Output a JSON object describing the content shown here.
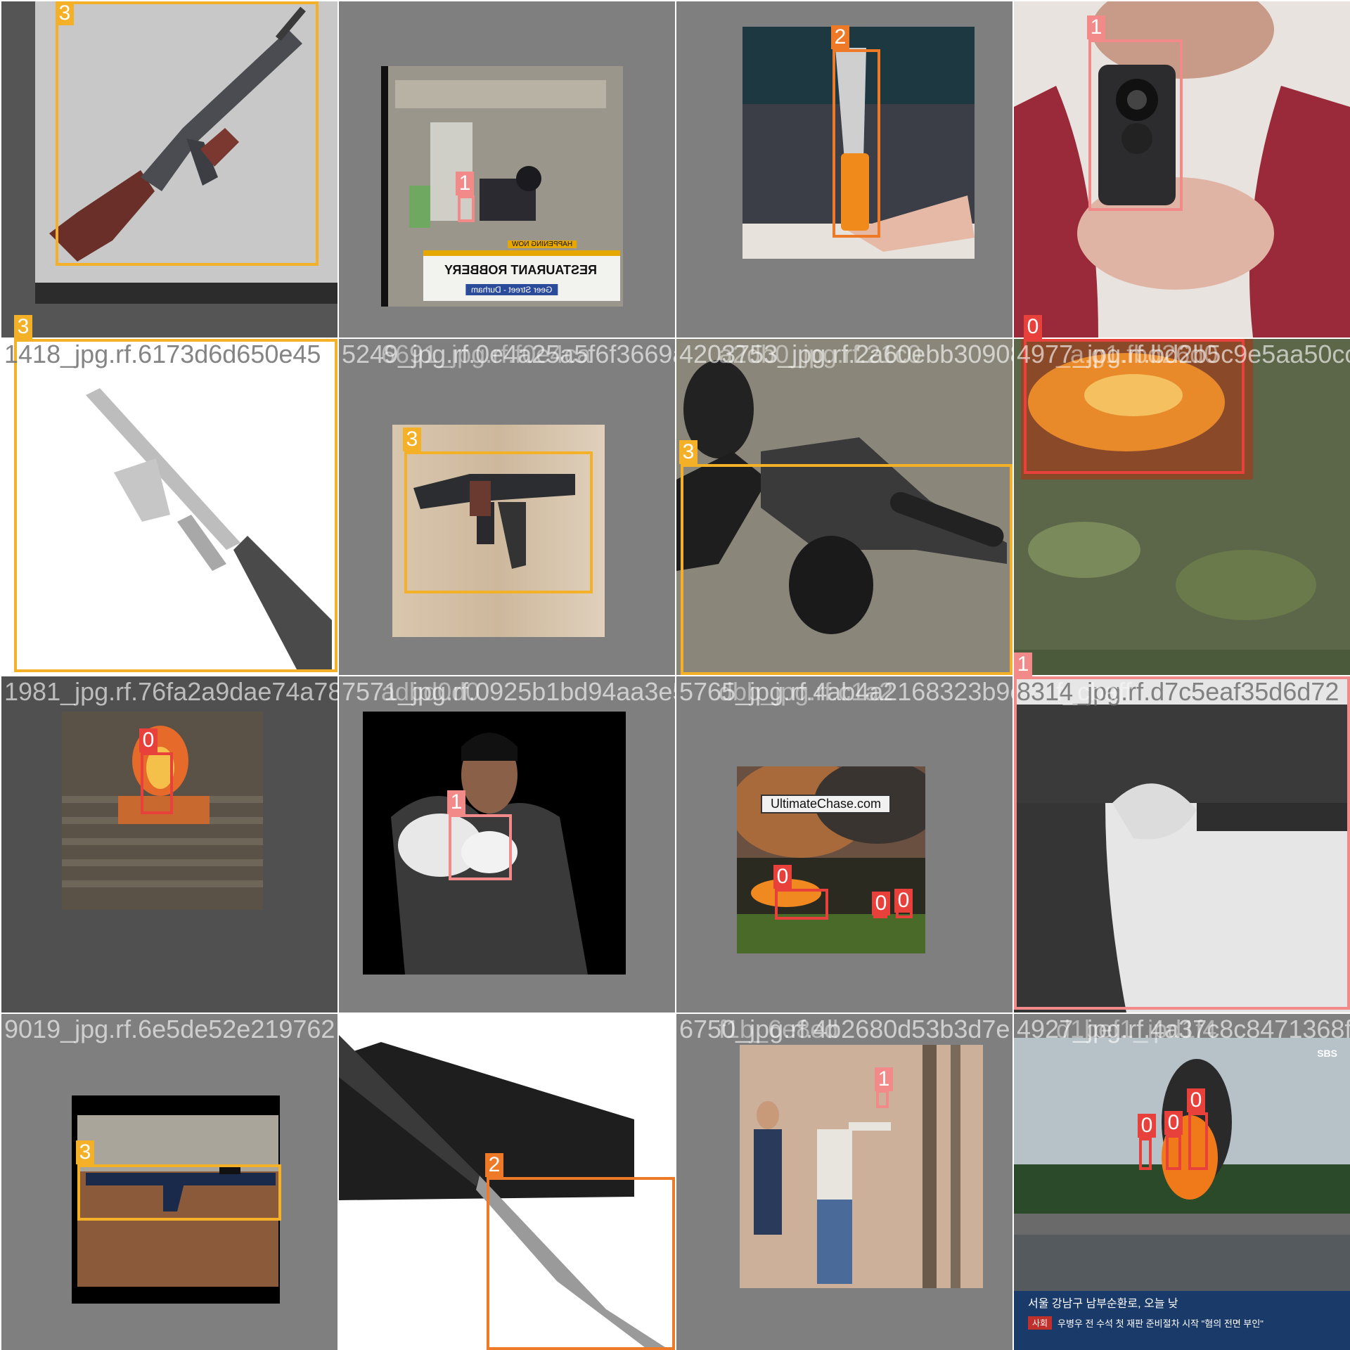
{
  "colors": {
    "class_0": "#e8403a",
    "class_1": "#f28a8a",
    "class_2": "#ee7a28",
    "class_3": "#f4b128",
    "padding_gray": "#808080",
    "text_overlay": "#d8d8d8"
  },
  "tiles": [
    {
      "filename": "",
      "boxes": [
        {
          "label": "3"
        }
      ],
      "scene": "rifle-3d-render"
    },
    {
      "filename": "",
      "boxes": [
        {
          "label": "1"
        }
      ],
      "scene": "cctv-robbery",
      "overlay": {
        "line1": "HAPPENING NOW",
        "line2": "RESTAURANT ROBBERY",
        "line3": "Geer Street - Durham"
      }
    },
    {
      "filename": "",
      "boxes": [
        {
          "label": "2"
        }
      ],
      "scene": "knife-on-laptop"
    },
    {
      "filename": "",
      "boxes": [
        {
          "label": "1"
        }
      ],
      "scene": "woman-pointing-pistol"
    },
    {
      "filename": "1418_jpg.rf.6173d6d650e45",
      "boxes": [
        {
          "label": "3"
        }
      ],
      "scene": "rifle-white-bg"
    },
    {
      "filename": "5249_jpg.rf.0e4a25a5f6f3669a2",
      "filename_overlap": "6691_jpg.rf.f0e4ca",
      "boxes": [
        {
          "label": "3"
        }
      ],
      "scene": "ak-on-wood-floor"
    },
    {
      "filename": "4203753_jpg.rf.2a60ebb30908e",
      "filename_overlap": "a2db0_jpg.rf.21c0",
      "boxes": [
        {
          "label": "3"
        }
      ],
      "scene": "smg-with-suppressor"
    },
    {
      "filename": "4977_jpg.rf.bd2b5c9e5aa50cc",
      "filename_overlap": "_a.g1.fbd26d0",
      "boxes": [
        {
          "label": "0"
        }
      ],
      "scene": "fire-in-leaves"
    },
    {
      "filename": "1981_jpg.rf.76fa2a9dae74a78",
      "boxes": [
        {
          "label": "0"
        }
      ],
      "scene": "fire-on-steps"
    },
    {
      "filename": "7571_jpg.rf.0925b1bd94aa3e5",
      "filename_overlap": "adbd0d0",
      "boxes": [
        {
          "label": "1"
        }
      ],
      "scene": "man-aiming-pistol"
    },
    {
      "filename": "5765_jpg.rf.4ab4a2168323b9cbe",
      "filename_overlap": "dbb_jpg.rf.c1a2",
      "boxes": [
        {
          "label": "0"
        },
        {
          "label": "0"
        },
        {
          "label": "0"
        }
      ],
      "scene": "forest-fire",
      "caption": "UltimateChase.com"
    },
    {
      "filename": "8314_jpg.rf.d7c5eaf35d6d72",
      "filename_overlap": "f_cbaff",
      "boxes": [
        {
          "label": "1"
        }
      ],
      "scene": "pistol-closeup"
    },
    {
      "filename": "9019_jpg.rf.6e5de52e219762",
      "boxes": [
        {
          "label": "3"
        }
      ],
      "scene": "ak-on-rust"
    },
    {
      "filename": "4319_jpg.rf.0f1127d57a680376",
      "filename_overlap": "84dd0_fd42c",
      "boxes": [
        {
          "label": "2"
        }
      ],
      "scene": "folding-knife"
    },
    {
      "filename": "6750_jpg.rf.4b2680d53b3d7e",
      "filename_overlap": "f1b_6e8ed",
      "boxes": [
        {
          "label": "1"
        }
      ],
      "scene": "man-shooting-outdoors"
    },
    {
      "filename": "4927_jpg.rf.4a37c8c8471368f6",
      "filename_overlap": "d1bef1_ipd1f4",
      "boxes": [
        {
          "label": "0"
        },
        {
          "label": "0"
        },
        {
          "label": "0"
        }
      ],
      "scene": "highway-explosion",
      "overlay": {
        "line1": "서울 강남구 남부순환로, 오늘 낮",
        "line2": "우병우 전 수석 첫 재판 준비절차 시작 \"혐의 전면 부인\"",
        "badge": "SBS",
        "tag": "사회"
      }
    }
  ]
}
